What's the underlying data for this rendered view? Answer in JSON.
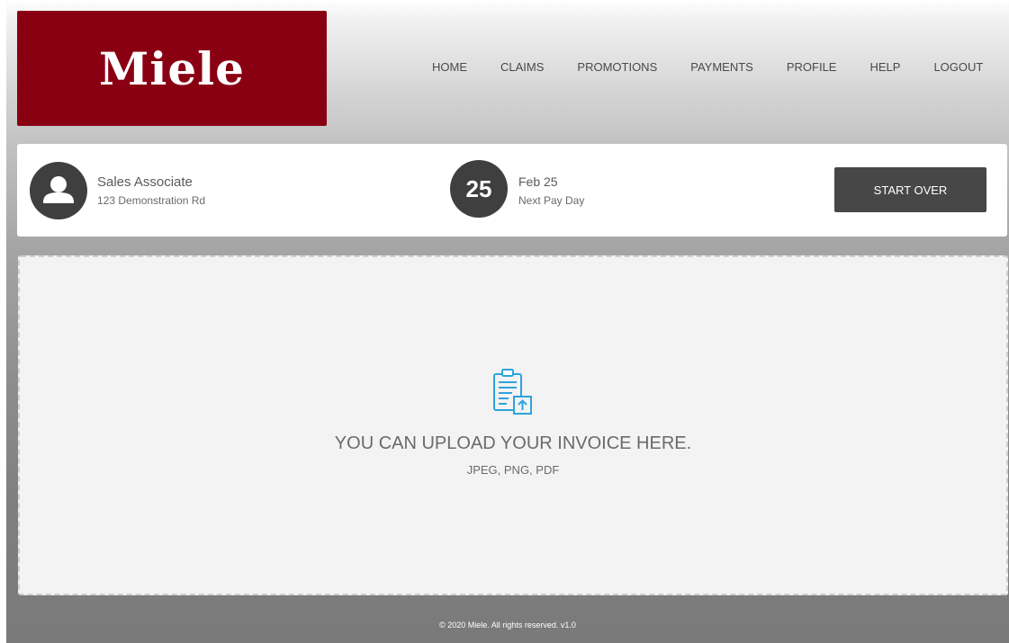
{
  "brand": {
    "logo_text": "Miele",
    "logo_color": "#8a0013"
  },
  "nav": {
    "items": [
      {
        "label": "HOME"
      },
      {
        "label": "CLAIMS"
      },
      {
        "label": "PROMOTIONS"
      },
      {
        "label": "PAYMENTS"
      },
      {
        "label": "PROFILE"
      },
      {
        "label": "HELP"
      },
      {
        "label": "LOGOUT"
      }
    ]
  },
  "user": {
    "name": "Sales Associate",
    "address": "123 Demonstration Rd",
    "avatar_icon": "person-icon"
  },
  "pay": {
    "day": "25",
    "date": "Feb 25",
    "label": "Next Pay Day"
  },
  "actions": {
    "start_over": "START OVER"
  },
  "upload": {
    "icon": "clipboard-upload-icon",
    "title": "YOU CAN UPLOAD YOUR INVOICE HERE.",
    "formats": "JPEG, PNG, PDF",
    "icon_color": "#2ea3dc"
  },
  "footer": {
    "text": "© 2020 Miele. All rights reserved. v1.0"
  }
}
